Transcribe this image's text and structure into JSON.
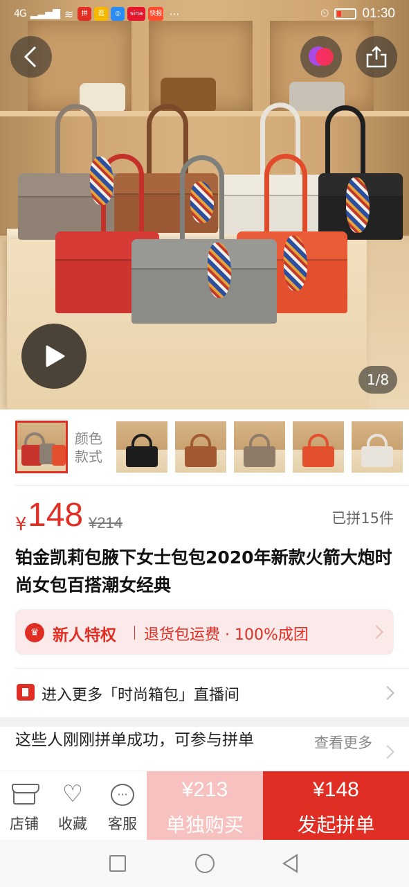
{
  "status_bar": {
    "signal": "4G",
    "time": "01:30",
    "app_icons": [
      "拼",
      "逛",
      "◎",
      "sina",
      "快报"
    ]
  },
  "hero": {
    "image_counter": "1/8",
    "icons": {
      "back": "back-arrow-icon",
      "brand": "brand-logo-icon",
      "share": "share-icon",
      "play": "play-icon"
    }
  },
  "gallery": {
    "color_label": "颜色款式",
    "thumbnails": [
      {
        "colors": [
          "#c8322c",
          "#8b7f73",
          "#b85a2e"
        ],
        "selected": true
      },
      {
        "colors": [
          "#1d1d1d"
        ],
        "selected": false
      },
      {
        "colors": [
          "#a35a33"
        ],
        "selected": false
      },
      {
        "colors": [
          "#8f7c68"
        ],
        "selected": false
      },
      {
        "colors": [
          "#e2502e"
        ],
        "selected": false
      },
      {
        "colors": [
          "#e8e4dc"
        ],
        "selected": false
      }
    ]
  },
  "price": {
    "currency": "¥",
    "current": "148",
    "original": "¥214",
    "sold": "已拼15件"
  },
  "product": {
    "title": "铂金凯莉包腋下女士包包2020年新款火箭大炮时尚女包百搭潮女经典"
  },
  "promo": {
    "title": "新人特权",
    "text": "退货包运费 · 100%成团"
  },
  "live": {
    "text": "进入更多「时尚箱包」直播间"
  },
  "group_buy": {
    "text": "这些人刚刚拼单成功，可参与拼单",
    "see_more": "查看更多"
  },
  "bottom_bar": {
    "store": "店铺",
    "favorite": "收藏",
    "service": "客服",
    "solo_price": "¥213",
    "solo_label": "单独购买",
    "group_price": "¥148",
    "group_label": "发起拼单"
  },
  "colors": {
    "accent": "#e02e24",
    "solo_bg": "#f6c1be",
    "promo_bg": "#fbeaea"
  }
}
